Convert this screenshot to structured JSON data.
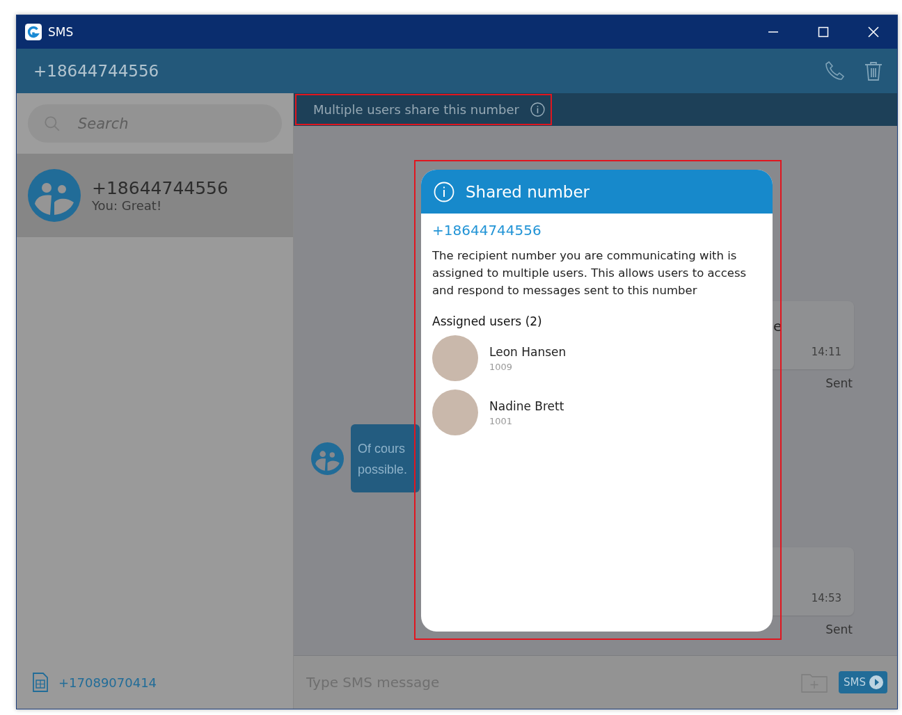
{
  "window": {
    "title": "SMS",
    "buttons": [
      {
        "kind": "minimize"
      },
      {
        "kind": "maximize"
      },
      {
        "kind": "close"
      }
    ]
  },
  "header": {
    "number": "+18644744556"
  },
  "sidebar": {
    "search": {
      "placeholder": "Search"
    },
    "conversations": [
      {
        "number": "+18644744556",
        "preview": "You: Great!",
        "selected": true
      }
    ],
    "own_number": "+17089070414"
  },
  "banner": {
    "text": "Multiple users share this number",
    "highlighted": true
  },
  "messages": [
    {
      "kind": "sent",
      "text": "e",
      "time": "14:11",
      "status": "Sent"
    },
    {
      "kind": "received",
      "lines": [
        "Of cours",
        "possible."
      ]
    },
    {
      "kind": "sent",
      "time": "14:53",
      "status": "Sent"
    }
  ],
  "composer": {
    "placeholder": "Type SMS message",
    "send": "SMS"
  },
  "dialog": {
    "title": "Shared number",
    "number": "+18644744556",
    "description": "The recipient number you are communicating with is assigned to multiple users. This allows users to access and respond to messages sent to this number",
    "users_heading": "Assigned users (2)",
    "users": [
      {
        "name": "Leon Hansen",
        "extension": "1009"
      },
      {
        "name": "Nadine Brett",
        "extension": "1001"
      }
    ],
    "highlighted": true
  }
}
